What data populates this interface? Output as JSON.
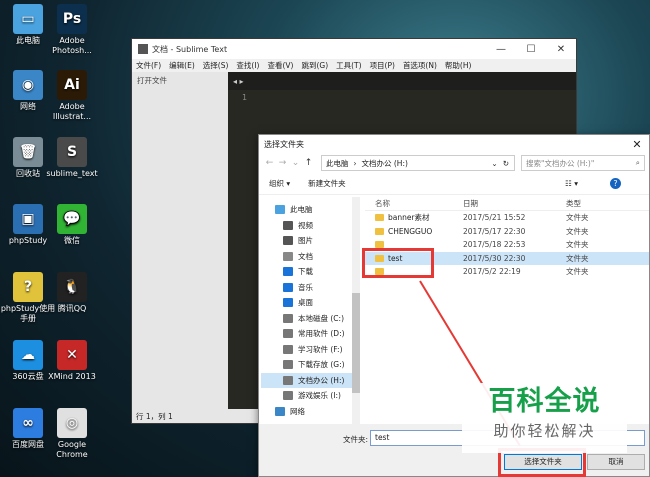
{
  "desktop": {
    "icons": [
      {
        "label": "此电脑",
        "glyph": "▭",
        "color": "#4aa3df"
      },
      {
        "label": "Adobe Photosh...",
        "glyph": "Ps",
        "color": "#0c2f4d"
      },
      {
        "label": "网络",
        "glyph": "◉",
        "color": "#3b86c6"
      },
      {
        "label": "Adobe Illustrat...",
        "glyph": "Ai",
        "color": "#2a1a06"
      },
      {
        "label": "回收站",
        "glyph": "🗑",
        "color": "#7a8d96"
      },
      {
        "label": "sublime_text",
        "glyph": "S",
        "color": "#4a4a4a"
      },
      {
        "label": "phpStudy",
        "glyph": "▣",
        "color": "#2b6fb3"
      },
      {
        "label": "微信",
        "glyph": "💬",
        "color": "#31b334"
      },
      {
        "label": "phpStudy使用手册",
        "glyph": "?",
        "color": "#e0c33a"
      },
      {
        "label": "腾讯QQ",
        "glyph": "🐧",
        "color": "#222222"
      },
      {
        "label": "360云盘",
        "glyph": "☁",
        "color": "#1d8fe0"
      },
      {
        "label": "XMind 2013",
        "glyph": "✕",
        "color": "#c62828"
      },
      {
        "label": "百度网盘",
        "glyph": "∞",
        "color": "#2d7de0"
      },
      {
        "label": "Google Chrome",
        "glyph": "◎",
        "color": "#e0e0e0"
      }
    ]
  },
  "sublime": {
    "title": "文档 - Sublime Text",
    "controls": {
      "minimize": "—",
      "maximize": "☐",
      "close": "✕"
    },
    "menu": [
      "文件(F)",
      "编辑(E)",
      "选择(S)",
      "查找(I)",
      "查看(V)",
      "跳到(G)",
      "工具(T)",
      "项目(P)",
      "首选项(N)",
      "帮助(H)"
    ],
    "sidebar_header": "打开文件",
    "tab_arrows": "◂ ▸",
    "line_number": "1",
    "status": "行 1，列 1"
  },
  "dialog": {
    "title": "选择文件夹",
    "close": "✕",
    "nav": {
      "back": "←",
      "forward": "→",
      "down": "⌄",
      "up": "↑"
    },
    "path": [
      "此电脑",
      "›",
      "文档办公 (H:)"
    ],
    "path_dropdown": "⌄",
    "refresh": "↻",
    "search_placeholder": "搜索\"文档办公 (H:)\"",
    "search_icon": "⌕",
    "toolbar": {
      "organize": "组织 ▾",
      "new_folder": "新建文件夹",
      "view": "☷ ▾",
      "help": "?"
    },
    "nav_items": [
      {
        "label": "此电脑",
        "color": "#4aa3df"
      },
      {
        "label": "视频",
        "color": "#555555"
      },
      {
        "label": "图片",
        "color": "#555555"
      },
      {
        "label": "文档",
        "color": "#888888"
      },
      {
        "label": "下载",
        "color": "#1a73d9"
      },
      {
        "label": "音乐",
        "color": "#1a73d9"
      },
      {
        "label": "桌面",
        "color": "#1a73d9"
      },
      {
        "label": "本地磁盘 (C:)",
        "color": "#777777"
      },
      {
        "label": "常用软件 (D:)",
        "color": "#777777"
      },
      {
        "label": "学习软件 (F:)",
        "color": "#777777"
      },
      {
        "label": "下载存放 (G:)",
        "color": "#777777"
      },
      {
        "label": "文档办公 (H:)",
        "color": "#777777"
      },
      {
        "label": "游戏娱乐 (I:)",
        "color": "#777777"
      },
      {
        "label": "网络",
        "color": "#3b86c6"
      }
    ],
    "columns": {
      "name": "名称",
      "date": "日期",
      "type": "类型"
    },
    "files": [
      {
        "name": "banner素材",
        "date": "2017/5/21 15:52",
        "type": "文件夹"
      },
      {
        "name": "CHENGGUO",
        "date": "2017/5/17 22:30",
        "type": "文件夹"
      },
      {
        "name": "",
        "date": "2017/5/18 22:53",
        "type": "文件夹"
      },
      {
        "name": "test",
        "date": "2017/5/30 22:30",
        "type": "文件夹"
      },
      {
        "name": "",
        "date": "2017/5/2 22:19",
        "type": "文件夹"
      }
    ],
    "folder_label": "文件夹:",
    "folder_value": "test",
    "select_button": "选择文件夹",
    "cancel_button": "取消"
  },
  "watermark": {
    "line1": "百科全说",
    "line2": "助你轻松解决"
  }
}
